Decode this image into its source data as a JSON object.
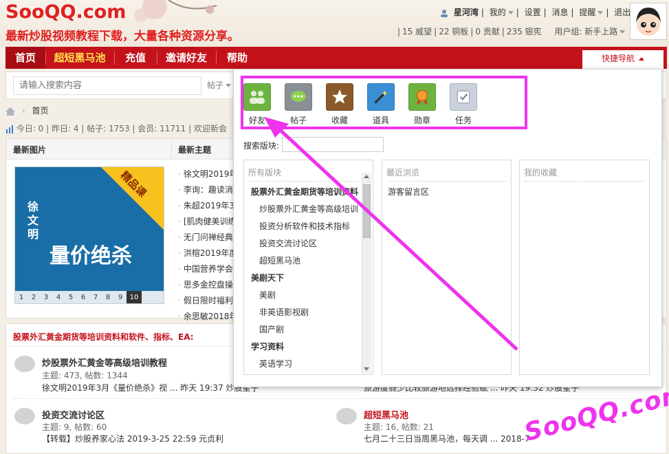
{
  "site": {
    "logo": "SooQQ.com",
    "slogan": "最新炒股视频教程下载，大量各种资源分享。"
  },
  "userbar": {
    "username": "星河湾",
    "mine": "我的",
    "settings": "设置",
    "messages": "消息",
    "remind": "提醒",
    "logout": "退出"
  },
  "stats_bar": {
    "weiwang": "15 威望",
    "tongban": "22 铜板",
    "gongxian": "0 贡献",
    "yinhao": "235 银宪",
    "usergroup": "用户组: 新手上路"
  },
  "nav": {
    "items": [
      "首页",
      "超短黑马池",
      "充值",
      "邀请好友",
      "帮助"
    ],
    "quick_nav": "快捷导航"
  },
  "search": {
    "placeholder": "请输入搜索内容",
    "type": "帖子"
  },
  "breadcrumb": {
    "home": "首页"
  },
  "board_stats": "今日: 0 | 昨日: 4 | 帖子: 1753 | 会员: 11711 | 欢迎新会",
  "panel": {
    "latest_images": "最新图片",
    "latest_threads": "最新主题",
    "slide": {
      "author": "徐文明",
      "title": "量价绝杀",
      "badge": "精品课",
      "pages": [
        "1",
        "2",
        "3",
        "4",
        "5",
        "6",
        "7",
        "8",
        "9",
        "10"
      ]
    },
    "threads": [
      "徐文明2019年",
      "李询：趣读消",
      "朱超2019年3",
      "[肌肉健美训练",
      "无门问禅经典",
      "洪榕2019年度",
      "中国营养学会",
      "思多金控盘操",
      "假日限时福利",
      "余思敏2018年"
    ]
  },
  "forum": {
    "category": "股票外汇黄金期货等培训资料和软件、指标、EA:",
    "boards": [
      {
        "name": "炒股票外汇黄金等高级培训教程",
        "info": "主题: 473, 帖数: 1344",
        "last": "徐文明2019年3月《量价绝杀》视 ... 昨天 19:37 炒股星子"
      },
      {
        "name": "投资交流讨论区",
        "info": "主题: 9, 帖数: 60",
        "last": "【转载】炒股养家心法 2019-3-25 22:59 元贞利"
      },
      {
        "name": "超短黑马池",
        "info": "主题: 16, 帖数: 21",
        "last": "七月二十三日当周黑马池，每天调 ... 2018-7"
      },
      {
        "name": "",
        "info": "",
        "last": "旅游度假少比较旅游地选择经验赋 ... 昨天 19:32 炒股星子"
      }
    ]
  },
  "quicknav_popup": {
    "tools": [
      "好友",
      "帖子",
      "收藏",
      "道具",
      "勋章",
      "任务"
    ],
    "search_label": "搜索版块:",
    "all_label": "所有版块",
    "recent_label": "最近浏览",
    "fav_label": "我的收藏",
    "all_forums": [
      {
        "name": "股票外汇黄金期货等培训资料",
        "bold": true
      },
      {
        "name": "炒股票外汇黄金等高级培训",
        "bold": false
      },
      {
        "name": "投资分析软件和技术指标",
        "bold": false
      },
      {
        "name": "投资交流讨论区",
        "bold": false
      },
      {
        "name": "超短黑马池",
        "bold": false
      },
      {
        "name": "美剧天下",
        "bold": true
      },
      {
        "name": "美剧",
        "bold": false
      },
      {
        "name": "非英语影视剧",
        "bold": false
      },
      {
        "name": "国产剧",
        "bold": false
      },
      {
        "name": "学习资料",
        "bold": true
      },
      {
        "name": "英语学习",
        "bold": false
      }
    ],
    "recent": [
      "游客留言区"
    ]
  },
  "watermark": "SooQQ.com",
  "colors": {
    "brand_red": "#c4121b",
    "highlight_magenta": "#ee33ee"
  },
  "icons": [
    "home-icon",
    "stats-icon",
    "friends-icon",
    "posts-icon",
    "favorites-icon",
    "props-icon",
    "medal-icon",
    "task-icon"
  ]
}
